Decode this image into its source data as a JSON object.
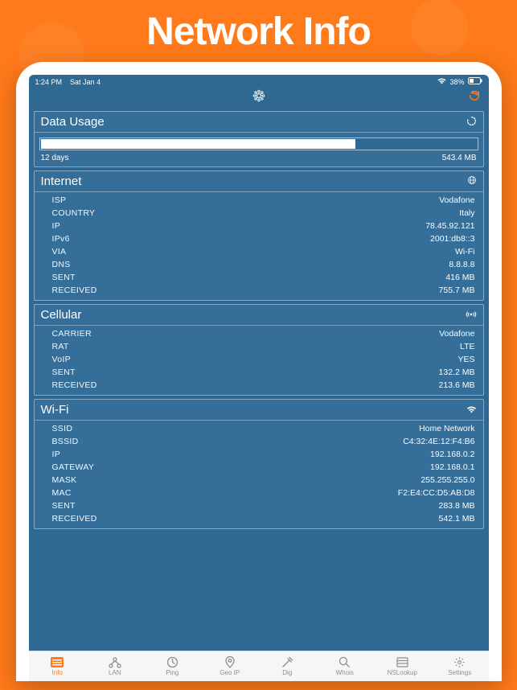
{
  "hero": {
    "title": "Network Info"
  },
  "status": {
    "time": "1:24 PM",
    "date": "Sat Jan 4",
    "battery": "38%"
  },
  "sections": {
    "dataUsage": {
      "title": "Data Usage",
      "period": "12 days",
      "total": "543.4 MB"
    },
    "internet": {
      "title": "Internet",
      "rows": [
        {
          "label": "ISP",
          "value": "Vodafone"
        },
        {
          "label": "COUNTRY",
          "value": "Italy"
        },
        {
          "label": "IP",
          "value": "78.45.92.121"
        },
        {
          "label": "IPv6",
          "value": "2001:db8::3"
        },
        {
          "label": "VIA",
          "value": "Wi-Fi"
        },
        {
          "label": "DNS",
          "value": "8.8.8.8"
        },
        {
          "label": "SENT",
          "value": "416 MB"
        },
        {
          "label": "RECEIVED",
          "value": "755.7 MB"
        }
      ]
    },
    "cellular": {
      "title": "Cellular",
      "rows": [
        {
          "label": "CARRIER",
          "value": "Vodafone"
        },
        {
          "label": "RAT",
          "value": "LTE"
        },
        {
          "label": "VoIP",
          "value": "YES"
        },
        {
          "label": "SENT",
          "value": "132.2 MB"
        },
        {
          "label": "RECEIVED",
          "value": "213.6 MB"
        }
      ]
    },
    "wifi": {
      "title": "Wi-Fi",
      "rows": [
        {
          "label": "SSID",
          "value": "Home Network"
        },
        {
          "label": "BSSID",
          "value": "C4:32:4E:12:F4:B6"
        },
        {
          "label": "IP",
          "value": "192.168.0.2"
        },
        {
          "label": "GATEWAY",
          "value": "192.168.0.1"
        },
        {
          "label": "MASK",
          "value": "255.255.255.0"
        },
        {
          "label": "MAC",
          "value": "F2:E4:CC:D5:AB:D8"
        },
        {
          "label": "SENT",
          "value": "283.8 MB"
        },
        {
          "label": "RECEIVED",
          "value": "542.1 MB"
        }
      ]
    }
  },
  "tabs": [
    {
      "label": "Info"
    },
    {
      "label": "LAN"
    },
    {
      "label": "Ping"
    },
    {
      "label": "Geo IP"
    },
    {
      "label": "Dig"
    },
    {
      "label": "Whois"
    },
    {
      "label": "NSLookup"
    },
    {
      "label": "Settings"
    }
  ]
}
